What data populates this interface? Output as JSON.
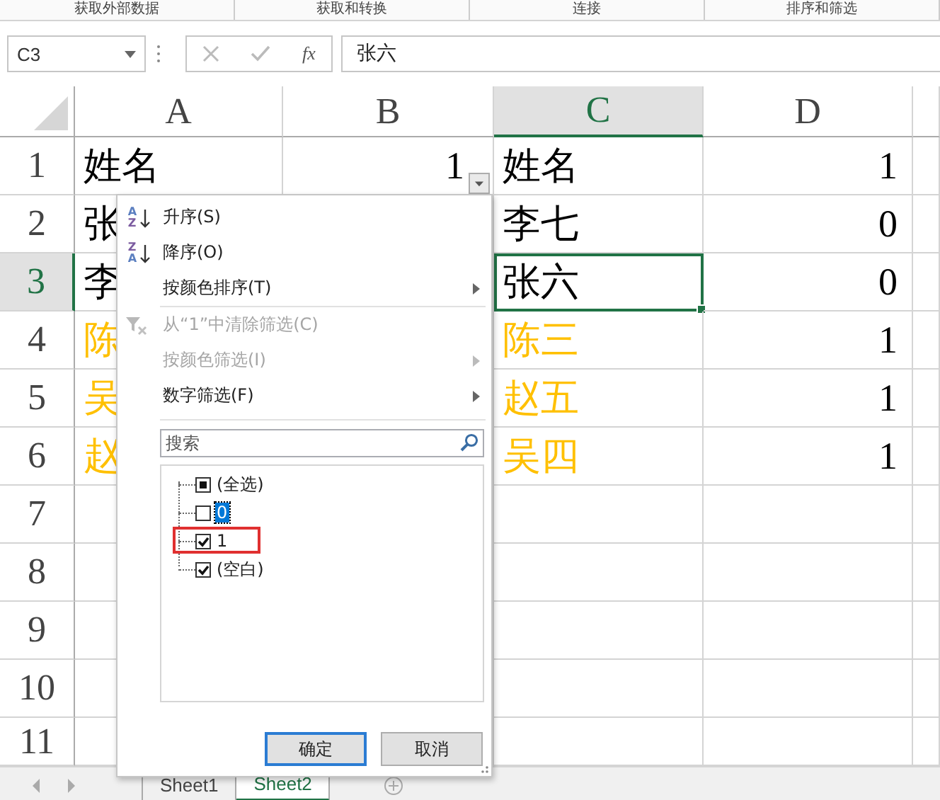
{
  "ribbon_groups": [
    "获取外部数据",
    "获取和转换",
    "连接",
    "排序和筛选"
  ],
  "name_box": {
    "value": "C3"
  },
  "formula_bar": {
    "function_label": "fx",
    "value": "张六"
  },
  "columns": [
    {
      "label": "A",
      "selected": false
    },
    {
      "label": "B",
      "selected": false
    },
    {
      "label": "C",
      "selected": true
    },
    {
      "label": "D",
      "selected": false
    }
  ],
  "rows": [
    {
      "label": "1",
      "selected": false,
      "a": {
        "text": "姓名",
        "kind": "text",
        "color": "#000000"
      },
      "b": {
        "text": "1",
        "kind": "number",
        "color": "#000000",
        "filter": true
      },
      "c": {
        "text": "姓名",
        "kind": "text",
        "color": "#000000",
        "active": false
      },
      "d": {
        "text": "1",
        "kind": "number",
        "color": "#000000"
      }
    },
    {
      "label": "2",
      "selected": false,
      "a": {
        "text": "张",
        "kind": "text",
        "color": "#000000"
      },
      "c": {
        "text": "李七",
        "kind": "text",
        "color": "#000000",
        "active": false
      },
      "d": {
        "text": "0",
        "kind": "number",
        "color": "#000000"
      }
    },
    {
      "label": "3",
      "selected": true,
      "a": {
        "text": "李",
        "kind": "text",
        "color": "#000000"
      },
      "c": {
        "text": "张六",
        "kind": "text",
        "color": "#000000",
        "active": true
      },
      "d": {
        "text": "0",
        "kind": "number",
        "color": "#000000"
      }
    },
    {
      "label": "4",
      "selected": false,
      "a": {
        "text": "陈",
        "kind": "text",
        "color": "#ffc000"
      },
      "c": {
        "text": "陈三",
        "kind": "text",
        "color": "#ffc000",
        "active": false
      },
      "d": {
        "text": "1",
        "kind": "number",
        "color": "#000000"
      }
    },
    {
      "label": "5",
      "selected": false,
      "a": {
        "text": "吴",
        "kind": "text",
        "color": "#ffc000"
      },
      "c": {
        "text": "赵五",
        "kind": "text",
        "color": "#ffc000",
        "active": false
      },
      "d": {
        "text": "1",
        "kind": "number",
        "color": "#000000"
      }
    },
    {
      "label": "6",
      "selected": false,
      "a": {
        "text": "赵",
        "kind": "text",
        "color": "#ffc000"
      },
      "c": {
        "text": "吴四",
        "kind": "text",
        "color": "#ffc000",
        "active": false
      },
      "d": {
        "text": "1",
        "kind": "number",
        "color": "#000000"
      }
    },
    {
      "label": "7",
      "selected": false
    },
    {
      "label": "8",
      "selected": false
    },
    {
      "label": "9",
      "selected": false
    },
    {
      "label": "10",
      "selected": false
    },
    {
      "label": "11",
      "selected": false
    }
  ],
  "filter_menu": {
    "items": [
      {
        "kind": "sort-asc",
        "icon_top": "A",
        "icon_bottom": "Z",
        "label": "升序(S)",
        "disabled": false,
        "submenu": false
      },
      {
        "kind": "sort-desc",
        "icon_top": "Z",
        "icon_bottom": "A",
        "label": "降序(O)",
        "disabled": false,
        "submenu": false
      },
      {
        "kind": "plain",
        "label": "按颜色排序(T)",
        "disabled": false,
        "submenu": true
      },
      {
        "kind": "separator"
      },
      {
        "kind": "clear-filter",
        "label": "从“1”中清除筛选(C)",
        "disabled": true,
        "submenu": false
      },
      {
        "kind": "plain",
        "label": "按颜色筛选(I)",
        "disabled": true,
        "submenu": true
      },
      {
        "kind": "plain",
        "label": "数字筛选(F)",
        "disabled": false,
        "submenu": true
      }
    ],
    "search": {
      "placeholder": "搜索"
    },
    "values": [
      {
        "label": "(全选)",
        "checked": false,
        "mixed": true,
        "selected": false,
        "marked": false
      },
      {
        "label": "0",
        "checked": false,
        "mixed": false,
        "selected": true,
        "marked": false
      },
      {
        "label": "1",
        "checked": true,
        "mixed": false,
        "selected": false,
        "marked": true
      },
      {
        "label": "(空白)",
        "checked": true,
        "mixed": false,
        "selected": false,
        "marked": false
      }
    ],
    "buttons": [
      {
        "label": "确定",
        "default": true
      },
      {
        "label": "取消",
        "default": false
      }
    ]
  },
  "sheet_tabs": [
    {
      "label": "Sheet1",
      "selected": false
    },
    {
      "label": "Sheet2",
      "selected": true
    }
  ]
}
